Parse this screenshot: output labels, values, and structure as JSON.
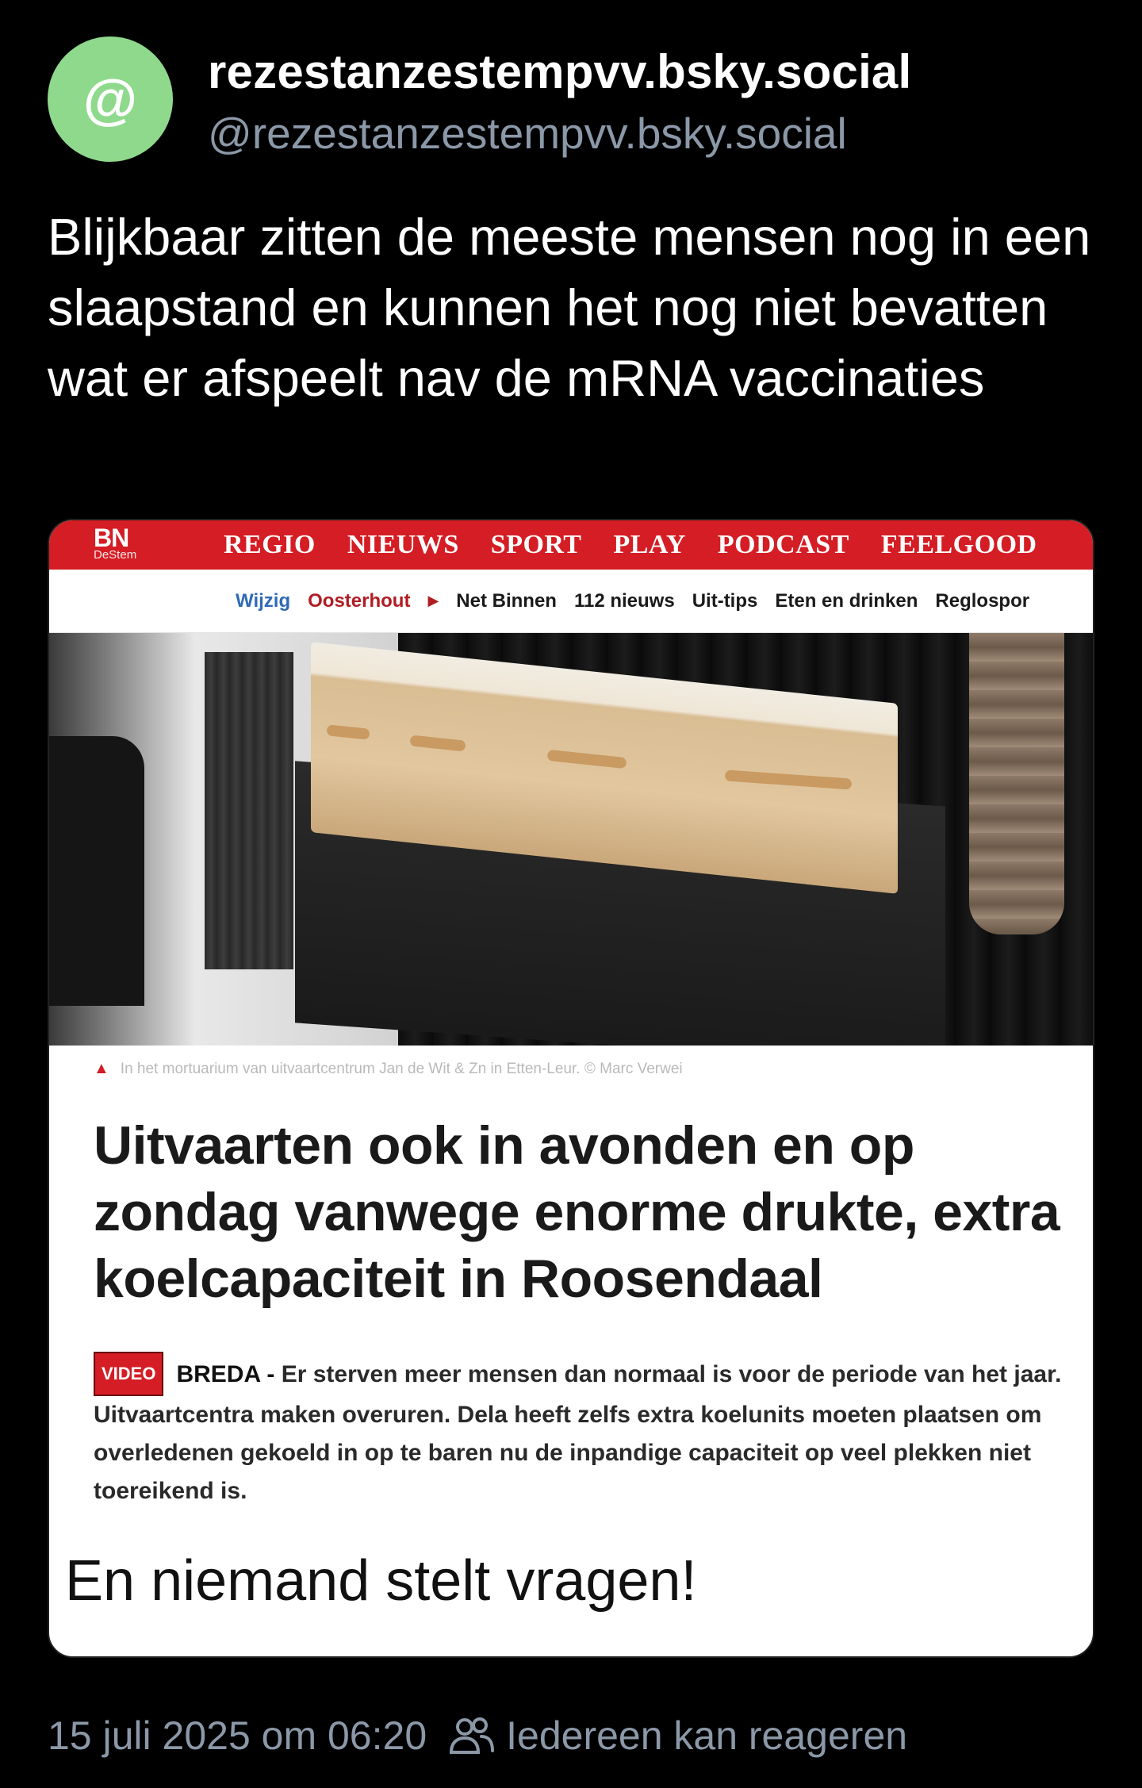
{
  "author": {
    "display_name": "rezestanzestempvv.bsky.social",
    "handle": "@rezestanzestempvv.bsky.social",
    "avatar_icon": "at-sign-icon",
    "avatar_glyph": "@",
    "avatar_color": "#8fd98c"
  },
  "post": {
    "text": "Blijkbaar zitten de meeste mensen nog in een slaapstand en kunnen het nog niet bevatten wat er afspeelt nav de mRNA vaccinaties"
  },
  "embed": {
    "site_logo": "BN",
    "site_logo_sub": "DeStem",
    "main_nav": [
      "REGIO",
      "NIEUWS",
      "SPORT",
      "PLAY",
      "PODCAST",
      "FEELGOOD"
    ],
    "sub_nav": {
      "edit": "Wijzig",
      "city": "Oosterhout",
      "items": [
        "Net Binnen",
        "112 nieuws",
        "Uit-tips",
        "Eten en drinken",
        "Reglospor"
      ]
    },
    "photo_caption": "In het mortuarium van uitvaartcentrum Jan de Wit & Zn in Etten-Leur. © Marc Verwei",
    "headline": "Uitvaarten ook in avonden en op zondag vanwege enorme drukte, extra koelcapaciteit in Roosendaal",
    "video_badge": "VIDEO",
    "lead_city": "BREDA -",
    "lead_text": "Er sterven meer mensen dan normaal is voor de periode van het jaar. Uitvaartcentra maken overuren. Dela heeft zelfs extra koelunits moeten plaatsen om overledenen gekoeld in op te baren nu de inpandige capaciteit op veel plekken niet toereikend is.",
    "overlay_text": "En niemand stelt vragen!",
    "brand_color": "#d41d24"
  },
  "footer": {
    "timestamp": "15 juli 2025 om 06:20",
    "reply_setting": "Iedereen kan reageren",
    "reply_icon": "people-icon"
  }
}
